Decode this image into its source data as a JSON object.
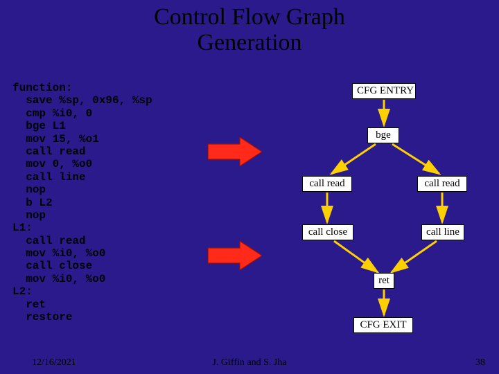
{
  "title_line1": "Control Flow Graph",
  "title_line2": "Generation",
  "code": "function:\n  save %sp, 0x96, %sp\n  cmp %i0, 0\n  bge L1\n  mov 15, %o1\n  call read\n  mov 0, %o0\n  call line\n  nop\n  b L2\n  nop\nL1:\n  call read\n  mov %i0, %o0\n  call close\n  mov %i0, %o0\nL2:\n  ret\n  restore",
  "nodes": {
    "entry": "CFG ENTRY",
    "bge": "bge",
    "call_read_left": "call read",
    "call_read_right": "call read",
    "call_close": "call close",
    "call_line": "call line",
    "ret": "ret",
    "exit": "CFG EXIT"
  },
  "footer": {
    "date": "12/16/2021",
    "center": "J. Giffin and S. Jha",
    "page": "38"
  },
  "colors": {
    "arrow_red": "#ff2a1a",
    "arrow_yellow": "#ffd000"
  }
}
